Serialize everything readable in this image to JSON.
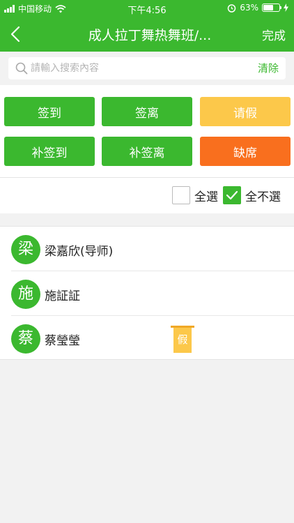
{
  "status_bar": {
    "carrier": "中国移动",
    "time": "下午4:56",
    "battery_percent": "63%",
    "battery_level": 0.63
  },
  "nav": {
    "title": "成人拉丁舞热舞班/...",
    "done_label": "完成"
  },
  "search": {
    "placeholder": "請輸入搜索內容",
    "clear_label": "清除"
  },
  "actions": {
    "check_in": "签到",
    "check_out": "签离",
    "leave": "请假",
    "make_up_check_in": "补签到",
    "make_up_check_out": "补签离",
    "absent": "缺席"
  },
  "selection": {
    "select_all": "全選",
    "select_none": "全不選",
    "select_all_checked": false,
    "select_none_checked": true
  },
  "colors": {
    "primary": "#3bb82f",
    "leave": "#fcc84a",
    "absent": "#f96f1e"
  },
  "students": [
    {
      "initial": "梁",
      "name": "梁嘉欣(导师)",
      "badge": ""
    },
    {
      "initial": "施",
      "name": "施証証",
      "badge": ""
    },
    {
      "initial": "蔡",
      "name": "蔡瑩瑩",
      "badge": "假"
    }
  ]
}
